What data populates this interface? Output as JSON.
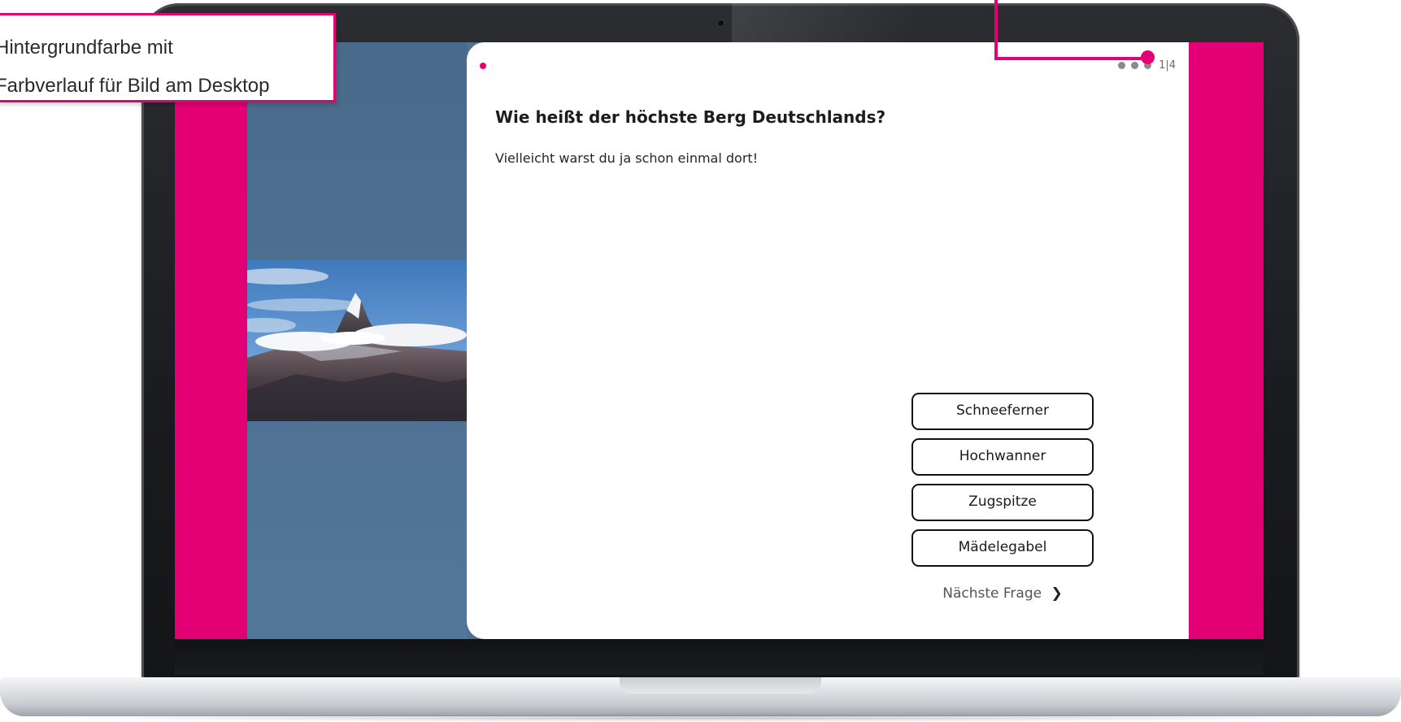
{
  "annotation": {
    "line1": "Hintergrundfarbe mit",
    "line2": "Farbverlauf für Bild am Desktop"
  },
  "quiz": {
    "progress": "1|4",
    "question": "Wie heißt der höchste Berg Deutschlands?",
    "subtitle": "Vielleicht warst du ja schon einmal dort!",
    "answers": [
      "Schneeferner",
      "Hochwanner",
      "Zugspitze",
      "Mädelegabel"
    ],
    "next_label": "Nächste Frage"
  },
  "colors": {
    "brand_magenta": "#e20074",
    "panel_blue": "#4d7093"
  },
  "icons": {
    "next": "chevron-right-icon"
  }
}
